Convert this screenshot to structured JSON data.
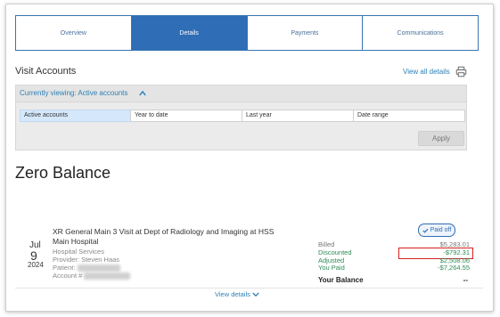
{
  "tabs": [
    {
      "label": "Overview",
      "active": false
    },
    {
      "label": "Details",
      "active": true
    },
    {
      "label": "Payments",
      "active": false
    },
    {
      "label": "Communications",
      "active": false
    }
  ],
  "header": {
    "title": "Visit Accounts",
    "view_all": "View all details",
    "print_icon": "printer-icon"
  },
  "filter": {
    "viewing": "Currently viewing: Active accounts",
    "options": [
      {
        "label": "Active accounts",
        "selected": true
      },
      {
        "label": "Year to date",
        "selected": false
      },
      {
        "label": "Last year",
        "selected": false
      },
      {
        "label": "Date range",
        "selected": false
      }
    ],
    "apply": "Apply"
  },
  "section": {
    "title": "Zero Balance"
  },
  "visit": {
    "month": "Jul",
    "day": "9",
    "year": "2024",
    "title": "XR General Main 3 Visit at Dept of Radiology and Imaging at HSS Main Hospital",
    "department": "Hospital Services",
    "provider": "Provider: Steven Haas",
    "patient_label": "Patient:",
    "account_label": "Account #",
    "status": "Paid off",
    "balances": [
      {
        "label": "Billed",
        "value": "$5,283.01",
        "tone": "gray"
      },
      {
        "label": "Discounted",
        "value": "-$792.31",
        "tone": "green"
      },
      {
        "label": "Adjusted",
        "value": "$2,508.06",
        "tone": "green"
      },
      {
        "label": "You Paid",
        "value": "-$7,264.55",
        "tone": "green"
      }
    ],
    "your_balance_label": "Your Balance",
    "your_balance_value": "--",
    "view_details": "View details"
  },
  "colors": {
    "accent": "#2f6db6",
    "link": "#2a80b9",
    "green": "#2e8b57",
    "highlight": "#d62020"
  }
}
